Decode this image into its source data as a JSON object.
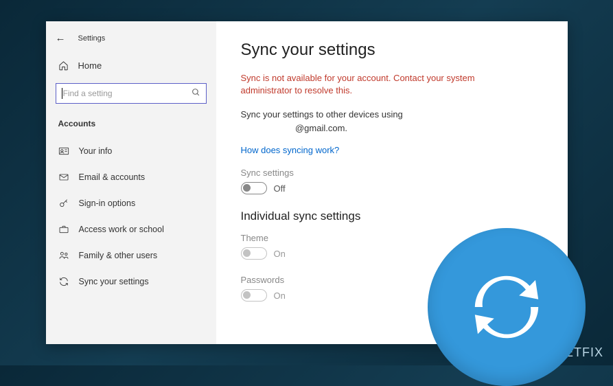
{
  "header": {
    "title": "Settings"
  },
  "sidebar": {
    "home_label": "Home",
    "search_placeholder": "Find a setting",
    "section_header": "Accounts",
    "items": [
      {
        "label": "Your info"
      },
      {
        "label": "Email & accounts"
      },
      {
        "label": "Sign-in options"
      },
      {
        "label": "Access work or school"
      },
      {
        "label": "Family & other users"
      },
      {
        "label": "Sync your settings"
      }
    ]
  },
  "main": {
    "title": "Sync your settings",
    "error_message": "Sync is not available for your account. Contact your system administrator to resolve this.",
    "sync_desc_line1": "Sync your settings to other devices using",
    "sync_desc_line2": "@gmail.com.",
    "link_text": "How does syncing work?",
    "sync_settings_label": "Sync settings",
    "sync_settings_state": "Off",
    "individual_header": "Individual sync settings",
    "theme_label": "Theme",
    "theme_state": "On",
    "passwords_label": "Passwords",
    "passwords_state": "On"
  },
  "watermark": "UGETFIX"
}
